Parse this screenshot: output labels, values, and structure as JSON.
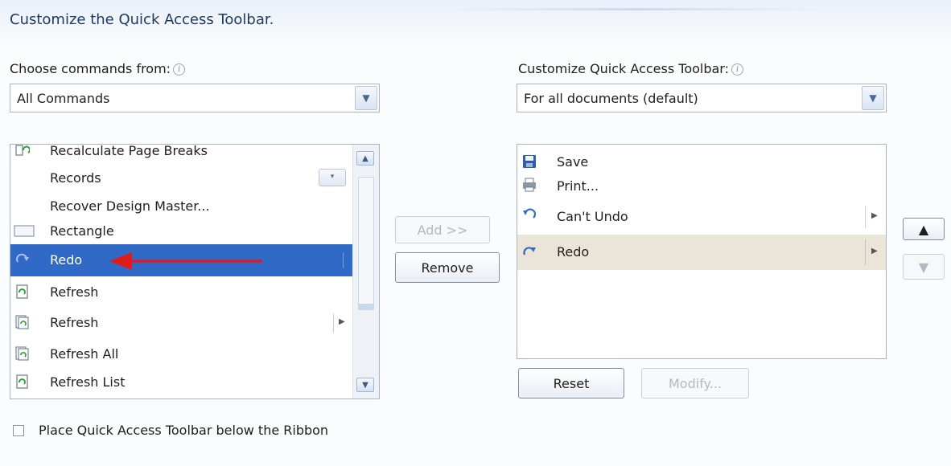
{
  "title": "Customize the Quick Access Toolbar.",
  "left": {
    "label": "Choose commands from:",
    "combo_value": "All Commands",
    "partial_top_item": "Recalculate Page Breaks",
    "items": [
      {
        "label": "Records",
        "icon": "none"
      },
      {
        "label": "Recover Design Master...",
        "icon": "none"
      },
      {
        "label": "Rectangle",
        "icon": "rectangle-icon"
      },
      {
        "label": "Redo",
        "icon": "redo-icon",
        "selected": true
      },
      {
        "label": "Refresh",
        "icon": "refresh-icon"
      },
      {
        "label": "Refresh",
        "icon": "refresh-stack-icon",
        "submenu": true
      },
      {
        "label": "Refresh All",
        "icon": "refresh-all-icon"
      },
      {
        "label": "Refresh List",
        "icon": "refresh-list-icon"
      }
    ]
  },
  "middle": {
    "add_label": "Add >>",
    "remove_label": "Remove"
  },
  "right": {
    "label": "Customize Quick Access Toolbar:",
    "combo_value": "For all documents (default)",
    "items": [
      {
        "label": "Save",
        "icon": "save-icon"
      },
      {
        "label": "Print...",
        "icon": "print-icon"
      },
      {
        "label": "Can't Undo",
        "icon": "undo-icon",
        "submenu": true
      },
      {
        "label": "Redo",
        "icon": "redo-icon",
        "submenu": true,
        "selected": true
      }
    ],
    "reset_label": "Reset",
    "modify_label": "Modify..."
  },
  "checkbox_label": "Place Quick Access Toolbar below the Ribbon",
  "colors": {
    "selection": "#3169c6",
    "annotation_arrow": "#e01b1b",
    "right_selection": "#ebe4d8"
  }
}
